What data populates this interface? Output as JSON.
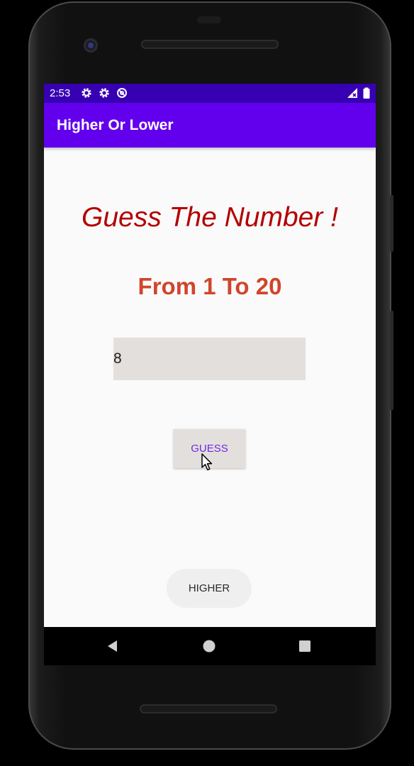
{
  "status_bar": {
    "time": "2:53",
    "icons": [
      "gear-icon",
      "gear-icon",
      "data-saver-icon",
      "signal-icon",
      "battery-icon"
    ]
  },
  "app_bar": {
    "title": "Higher Or Lower"
  },
  "main": {
    "headline": "Guess The Number !",
    "range_text": "From 1 To 20",
    "number_input_value": "8",
    "guess_button_label": "GUESS",
    "result_button_label": "HIGHER"
  },
  "navigation": {
    "icons": [
      "back-icon",
      "home-icon",
      "recents-icon"
    ]
  },
  "colors": {
    "status_bar": "#3700b3",
    "app_bar": "#6200ee",
    "headline": "#b30000",
    "range_text": "#d0452c",
    "guess_text": "#6d2ce0"
  }
}
